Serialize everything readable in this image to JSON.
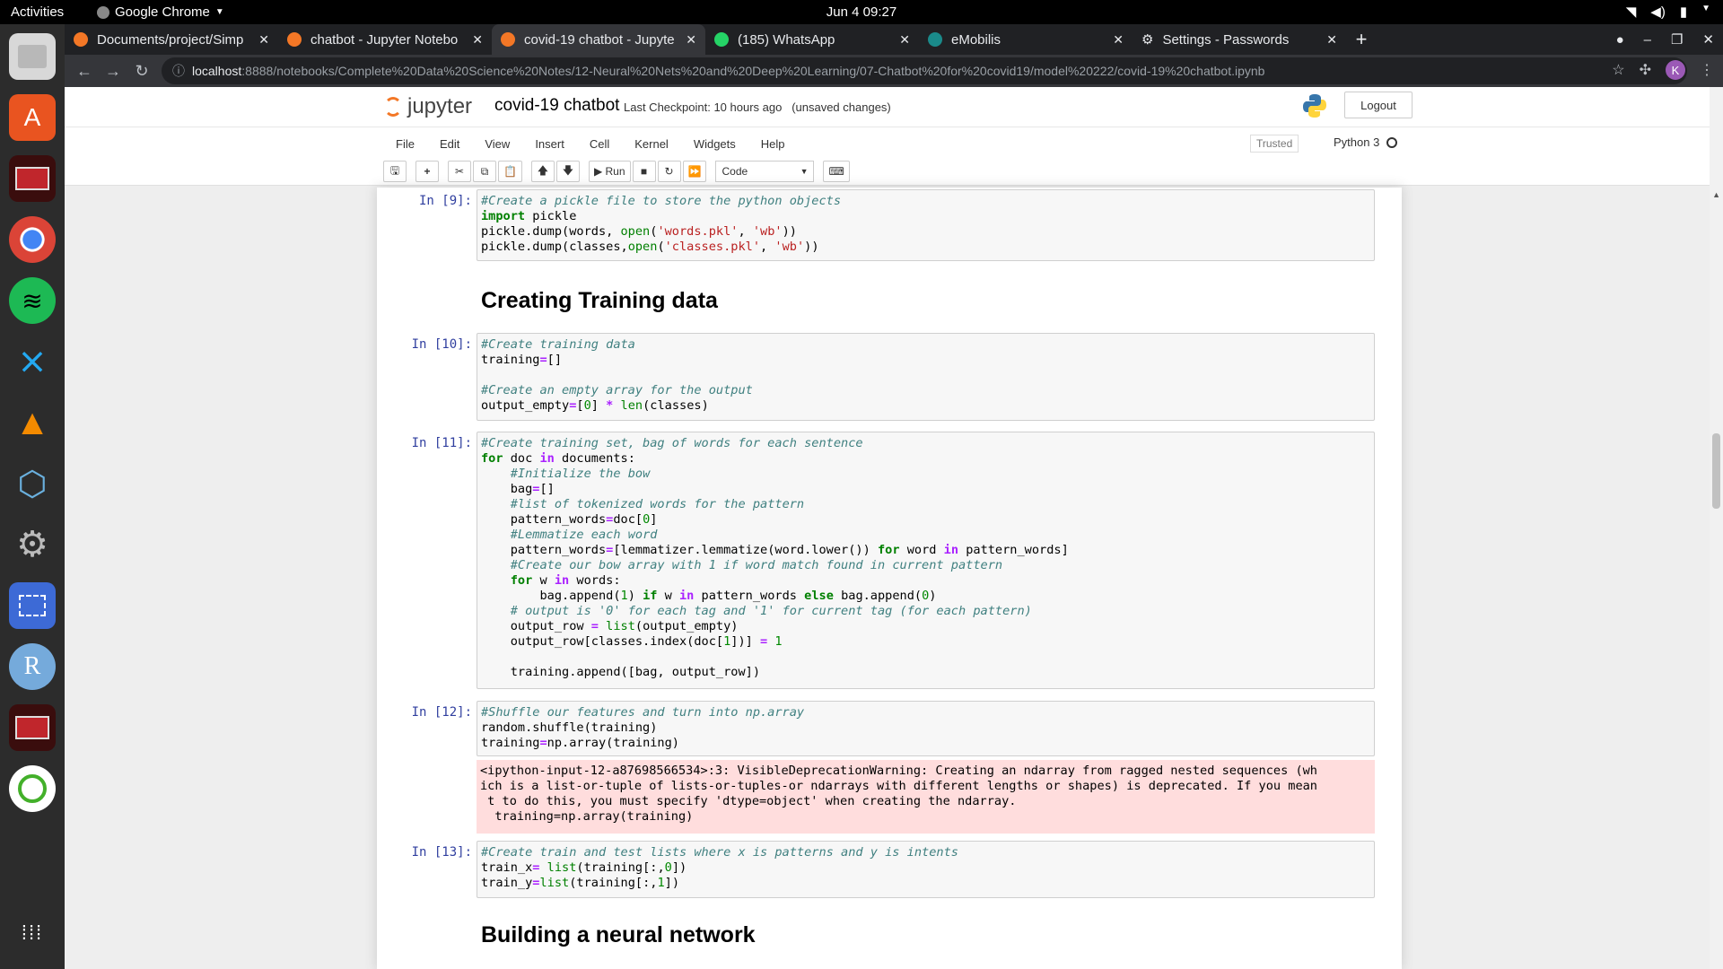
{
  "system": {
    "activities": "Activities",
    "app_name": "Google Chrome",
    "clock": "Jun 4  09:27"
  },
  "browser": {
    "tabs": [
      {
        "label": "Documents/project/Simp",
        "active": false
      },
      {
        "label": "chatbot - Jupyter Notebo",
        "active": false
      },
      {
        "label": "covid-19 chatbot - Jupyte",
        "active": true
      },
      {
        "label": "(185) WhatsApp",
        "active": false
      },
      {
        "label": "eMobilis",
        "active": false
      },
      {
        "label": "Settings - Passwords",
        "active": false
      }
    ],
    "url_host": "localhost",
    "url_rest": ":8888/notebooks/Complete%20Data%20Science%20Notes/12-Neural%20Nets%20and%20Deep%20Learning/07-Chatbot%20for%20covid19/model%20222/covid-19%20chatbot.ipynb",
    "profile_initial": "K"
  },
  "jupyter": {
    "logo_text": "jupyter",
    "notebook_title": "covid-19 chatbot",
    "checkpoint": "Last Checkpoint: 10 hours ago",
    "unsaved": "(unsaved changes)",
    "logout": "Logout",
    "menu": [
      "File",
      "Edit",
      "View",
      "Insert",
      "Cell",
      "Kernel",
      "Widgets",
      "Help"
    ],
    "trusted": "Trusted",
    "kernel_name": "Python 3",
    "toolbar": {
      "run": "Run",
      "cell_type": "Code"
    }
  },
  "cells": {
    "c9": {
      "prompt": "In [9]:"
    },
    "md1": "Creating Training data",
    "c10": {
      "prompt": "In [10]:"
    },
    "c11": {
      "prompt": "In [11]:"
    },
    "c12": {
      "prompt": "In [12]:",
      "warning": "<ipython-input-12-a87698566534>:3: VisibleDeprecationWarning: Creating an ndarray from ragged nested sequences (wh\nich is a list-or-tuple of lists-or-tuples-or ndarrays with different lengths or shapes) is deprecated. If you mean\n t to do this, you must specify 'dtype=object' when creating the ndarray.\n  training=np.array(training)"
    },
    "c13": {
      "prompt": "In [13]:"
    },
    "md2": "Building a neural network"
  }
}
